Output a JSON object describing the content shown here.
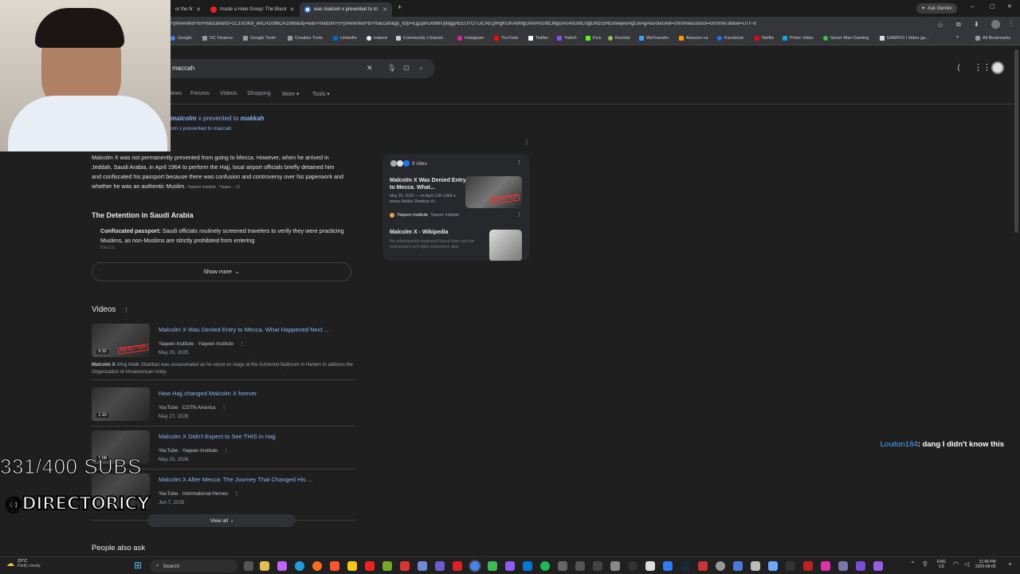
{
  "tabs": [
    {
      "label": "or the fir"
    },
    {
      "label": "Inside a Hate Group: The Black"
    },
    {
      "label": "was malcom x prevented to m"
    }
  ],
  "ask_gemini": "Ask Gemini",
  "url": "+prevented+to+maccah&rlz=1C1VDKB_enCA1086CA1086&oq=was+malcom+x+prevented+to+maccah&gs_lcrp=EgZjaHJvbWUyBggAEEUYOTIJCAEQIRgKGKABMgcIAhAhGI8CMgcIAxAhGI8C0gEINzc5NGowajeoAgCwAgA&sourceid=chrome&source=chrome.ob&ie=UTF-8",
  "bookmarks": [
    "Google",
    "DC Finance",
    "Google Tools",
    "Creative Tools",
    "LinkedIn",
    "Indeed",
    "Community | Glassd...",
    "Instagram",
    "YouTube",
    "Twitter",
    "Twitch",
    "Kick",
    "Rumble",
    "WeTransfer",
    "Amazon.ca",
    "Facebook",
    "Netflix",
    "Prime Video",
    "Green Man Gaming",
    "GAMIVO | Video ga...",
    "All Bookmarks"
  ],
  "search": {
    "query": "maccah"
  },
  "nav_tabs": [
    "iews",
    "Forums",
    "Videos",
    "Shopping",
    "More",
    "Tools"
  ],
  "correction": {
    "prefix": "maicolm",
    "mid": " x prevented to ",
    "word": "makkah",
    "sub": "om x prevented to maccah"
  },
  "overview": {
    "text": "Malcolm X was not permanently prevented from going to Mecca. However, when he arrived in Jeddah, Saudi Arabia, in April 1964 to perform the Hajj, local airport officials briefly detained him and confiscated his passport because there was confusion and controversy over his paperwork and whether he was an authentic Muslim.",
    "cite": "Yaqeen Institute · Yaqee... +2",
    "heading": "The Detention in Saudi Arabia",
    "bullet_bold": "Confiscated passport:",
    "bullet_text": " Saudi officials routinely screened travelers to verify they were practicing Muslims, as non-Muslims are strictly prohibited from entering",
    "bullet_cut": "Mecca.",
    "show_more": "Show more"
  },
  "sources": {
    "count": "9 sites",
    "card1": {
      "title": "Malcolm X Was Denied Entry to Mecca. What...",
      "snippet": "May 20, 2025 — on April 12th 1964 a weary Malika Shabbaz th...",
      "source": "Yaqeen Institute",
      "source2": "Yaqeen Institute",
      "thumb": "REJECTED"
    },
    "card2": {
      "title": "Malcolm X - Wikipedia",
      "snippet": "He subsequently embraced Sunni Islam and the mainstream civil rights movement, after"
    }
  },
  "videos": {
    "heading": "Videos",
    "items": [
      {
        "title": "Malcolm X Was Denied Entry to Mecca. What Happened Next ...",
        "source": "Yaqeen Institute · Yaqeen Institute",
        "date": "May 20, 2025",
        "duration": "9:32",
        "badge": "REJECTED"
      },
      {
        "title": "How Hajj changed Malcolm X forever",
        "source": "YouTube · CGTN America",
        "date": "May 27, 2026",
        "duration": "1:15",
        "badge": ""
      },
      {
        "title": "Malcolm X Didn't Expect to See THIS in Hajj",
        "source": "YouTube · Yaqeen Institute",
        "date": "May 20, 2026",
        "duration": "1:08",
        "badge": ""
      },
      {
        "title": "Malcolm X After Mecca: The Journey That Changed His ...",
        "source": "YouTube · Informational Heroes",
        "date": "Jun 7, 2025",
        "duration": "",
        "badge": ""
      }
    ],
    "snippet_bold": "Malcolm X",
    "snippet": " Alhaj Malik Shabbaz was assassinated as he stood on stage at the Autobond Ballroom in Harlem to address the Organization of Afroamerican Unity.",
    "view_all": "View all"
  },
  "people_also_ask": "People also ask",
  "chat": {
    "user": "Louiton184",
    "message": ": dang I didn't know this"
  },
  "overlay": {
    "subs": "331/400 SUBS",
    "handle": "@DIRECTORICY"
  },
  "taskbar": {
    "temp": "22°C",
    "weather": "Partly cloudy",
    "search": "Search",
    "lang1": "ENG",
    "lang2": "US",
    "time": "11:49 PM",
    "date": "2026-08-05"
  }
}
